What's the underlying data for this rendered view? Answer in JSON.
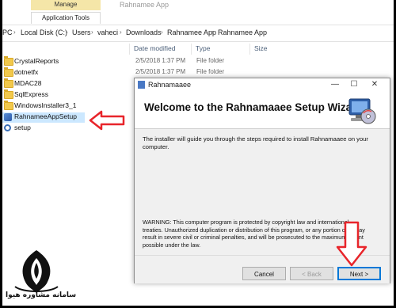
{
  "ribbon": {
    "context_tab": "Manage",
    "tools_tab": "Application Tools",
    "title": "Rahnamee App"
  },
  "address": {
    "root": "PC",
    "crumbs": [
      "Local Disk (C:)",
      "Users",
      "vaheci",
      "Downloads",
      "Rahnamee App",
      "Rahnamee App"
    ]
  },
  "columns": {
    "date": "Date modified",
    "type": "Type",
    "size": "Size"
  },
  "files": [
    {
      "name": "CrystalReports",
      "date": "2/5/2018 1:37 PM",
      "type": "File folder",
      "icon": "folder-icon"
    },
    {
      "name": "dotnetfx",
      "date": "2/5/2018 1:37 PM",
      "type": "File folder",
      "icon": "folder-icon"
    },
    {
      "name": "MDAC28",
      "date": "",
      "type": "",
      "icon": "folder-icon"
    },
    {
      "name": "SqlExpress",
      "date": "",
      "type": "",
      "icon": "folder-icon"
    },
    {
      "name": "WindowsInstaller3_1",
      "date": "",
      "type": "",
      "icon": "folder-icon"
    },
    {
      "name": "RahnameeAppSetup",
      "date": "",
      "type": "",
      "icon": "installer-icon"
    },
    {
      "name": "setup",
      "date": "",
      "type": "",
      "icon": "setup-gear-icon"
    }
  ],
  "dialog": {
    "title": "Rahnamaaee",
    "heading": "Welcome to the Rahnamaaee Setup Wizard",
    "intro": "The installer will guide you through the steps required to install Rahnamaaee on your computer.",
    "warning": "WARNING: This computer program is protected by copyright law and international treaties. Unauthorized duplication or distribution of this program, or any portion of it, may result in severe civil or criminal penalties, and will be prosecuted to the maximum extent possible under the law.",
    "cancel": "Cancel",
    "back": "< Back",
    "next": "Next >",
    "minimize": "—",
    "maximize": "☐",
    "close": "✕"
  },
  "logo": {
    "text": "سامانه مشاوره هیوا"
  },
  "colors": {
    "annotation": "#e8252b",
    "selection": "#cce8ff",
    "focus": "#0078d7"
  }
}
